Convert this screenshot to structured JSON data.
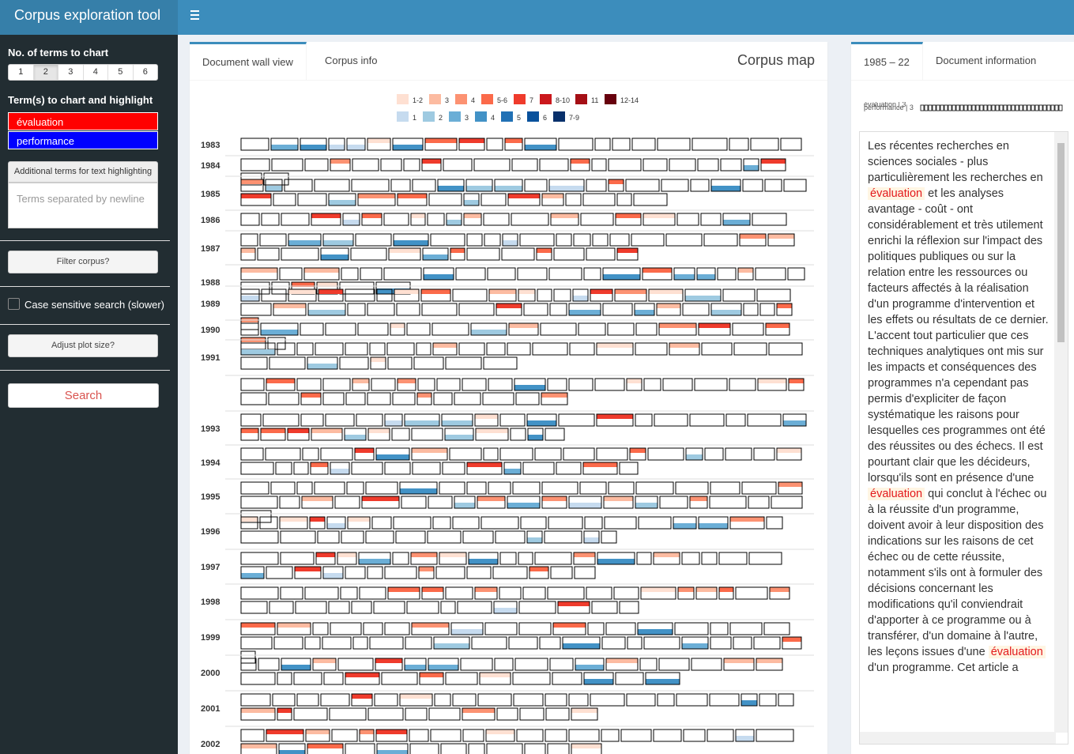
{
  "app": {
    "title": "Corpus exploration tool"
  },
  "sidebar": {
    "terms_count_label": "No. of terms to chart",
    "terms_count_options": [
      "1",
      "2",
      "3",
      "4",
      "5",
      "6"
    ],
    "terms_count_selected": "2",
    "terms_label": "Term(s) to chart and highlight",
    "terms": [
      {
        "value": "évaluation",
        "color": "#ff0000"
      },
      {
        "value": "performance",
        "color": "#0000ff"
      }
    ],
    "additional_terms_button": "Additional terms for text highlighting",
    "additional_terms_placeholder": "Terms separated by newline",
    "filter_button": "Filter corpus?",
    "case_sensitive_label": "Case sensitive search (slower)",
    "case_sensitive_checked": false,
    "adjust_button": "Adjust plot size?",
    "search_button": "Search"
  },
  "main": {
    "tabs": [
      "Document wall view",
      "Corpus info"
    ],
    "active_tab": "Document wall view",
    "title": "Corpus map"
  },
  "chart_data": {
    "type": "heatmap",
    "title": "",
    "legend": [
      {
        "term": "évaluation",
        "bins": [
          "1-2",
          "3",
          "4",
          "5-6",
          "7",
          "8-10",
          "11",
          "12-14"
        ],
        "colors": [
          "#fee0d2",
          "#fcbba1",
          "#fc9272",
          "#fb6a4a",
          "#ef3b2c",
          "#cb181d",
          "#a50f15",
          "#67000d"
        ]
      },
      {
        "term": "performance",
        "bins": [
          "1",
          "2",
          "3",
          "4",
          "5",
          "6",
          "7-9"
        ],
        "colors": [
          "#c6dbef",
          "#9ecae1",
          "#6baed6",
          "#4292c6",
          "#2171b5",
          "#08519c",
          "#08306b"
        ]
      }
    ],
    "years": [
      {
        "year": "1983",
        "docs": 21
      },
      {
        "year": "1984",
        "docs": 23
      },
      {
        "year": "1985",
        "docs": 36
      },
      {
        "year": "1986",
        "docs": 21
      },
      {
        "year": "1987",
        "docs": 34
      },
      {
        "year": "1988",
        "docs": 26
      },
      {
        "year": "1989",
        "docs": 41
      },
      {
        "year": "1990",
        "docs": 20
      },
      {
        "year": "1991",
        "docs": 29
      },
      {
        "year": "",
        "docs": 35
      },
      {
        "year": "1993",
        "docs": 32
      },
      {
        "year": "1994",
        "docs": 35
      },
      {
        "year": "1995",
        "docs": 39
      },
      {
        "year": "1996",
        "docs": 33
      },
      {
        "year": "1997",
        "docs": 34
      },
      {
        "year": "1998",
        "docs": 34
      },
      {
        "year": "1999",
        "docs": 39
      },
      {
        "year": "2000",
        "docs": 33
      },
      {
        "year": "2001",
        "docs": 33
      },
      {
        "year": "2002",
        "docs": 32
      }
    ]
  },
  "right": {
    "tabs": [
      "1985 – 22",
      "Document information"
    ],
    "active_tab": "1985 – 22",
    "doc_legend_terms": [
      "évaluation | 3",
      "performance | 3"
    ],
    "text_parts": [
      {
        "t": "Les récentes recherches en sciences sociales - plus particulièrement les recherches en "
      },
      {
        "t": "évaluation",
        "hl": true
      },
      {
        "t": " et les analyses avantage - coût - ont considérablement et très utilement enrichi la réflexion sur l'impact des politiques publiques ou sur la relation entre les ressources ou facteurs affectés à la réalisation d'un programme d'intervention et les effets ou résultats de ce dernier. L'accent tout particulier que ces techniques analytiques ont mis sur les impacts et conséquences des programmes n'a cependant pas permis d'expliciter de façon systématique les raisons pour lesquelles ces programmes ont été des réussites ou des échecs. Il est pourtant clair que les décideurs, lorsqu'ils sont en présence d'une "
      },
      {
        "t": "évaluation",
        "hl": true
      },
      {
        "t": " qui conclut à l'échec ou à la réussite d'un programme, doivent avoir à leur disposition des indications sur les raisons de cet échec ou de cette réussite, notamment s'ils ont à formuler des décisions concernant les modifications qu'il conviendrait d'apporter à ce programme ou à transférer, d'un domaine à l'autre, les leçons issues d'une "
      },
      {
        "t": "évaluation",
        "hl": true
      },
      {
        "t": " d'un programme. Cet article a"
      }
    ]
  }
}
